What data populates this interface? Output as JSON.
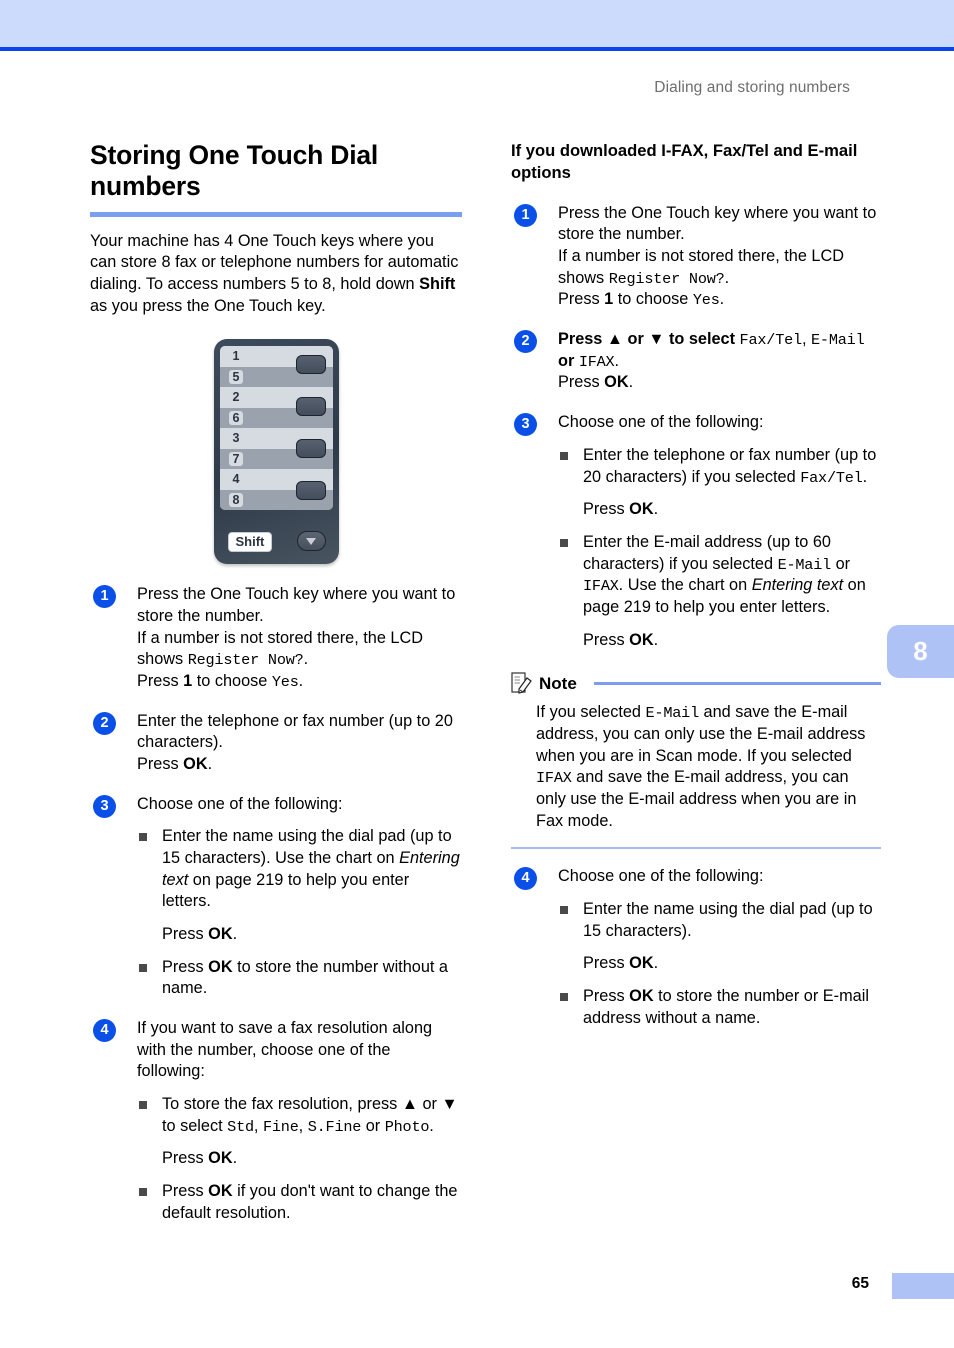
{
  "header": {
    "running_head": "Dialing and storing numbers",
    "band_color": "#ccdafb",
    "rule_color": "#0a44ee"
  },
  "left_column": {
    "title": "Storing One Touch Dial numbers",
    "intro_parts": {
      "a": "Your machine has 4 One Touch keys where you can store 8 fax or telephone numbers for automatic dialing. To access numbers 5 to 8, hold down ",
      "b": "Shift",
      "c": " as you press the One Touch key."
    },
    "figure": {
      "name": "one-touch-keypad",
      "rows": [
        {
          "top": "1",
          "bottom": "5"
        },
        {
          "top": "2",
          "bottom": "6"
        },
        {
          "top": "3",
          "bottom": "7"
        },
        {
          "top": "4",
          "bottom": "8"
        }
      ],
      "shift_label": "Shift",
      "down_icon": "chevron-down-icon"
    },
    "steps": [
      {
        "num": "1",
        "lines": [
          {
            "a": "Press the One Touch key where you want to store the number."
          },
          {
            "a": "If a number is not stored there, the LCD shows ",
            "mono": "Register Now?",
            "c": "."
          },
          {
            "a": "Press ",
            "b": "1",
            "c": " to choose ",
            "mono2": "Yes",
            "d": "."
          }
        ]
      },
      {
        "num": "2",
        "lines": [
          {
            "a": "Enter the telephone or fax number (up to 20 characters)."
          },
          {
            "a": "Press ",
            "b": "OK",
            "c": "."
          }
        ]
      },
      {
        "num": "3",
        "lines": [
          {
            "a": "Choose one of the following:"
          }
        ],
        "bullets": [
          {
            "a": "Enter the name using the dial pad (up to 15 characters). Use the chart on ",
            "italic": "Entering text",
            "c": " on page 219 to help you enter letters.",
            "press": {
              "a": "Press ",
              "b": "OK",
              "c": "."
            }
          },
          {
            "a": "Press ",
            "bold_inline": "OK",
            "c": " to store the number without a name."
          }
        ]
      },
      {
        "num": "4",
        "lines": [
          {
            "a": "If you want to save a fax resolution along with the number, choose one of the following:"
          }
        ],
        "bullets": [
          {
            "a": "To store the fax resolution, press ▲ or ▼ to select ",
            "mono": "Std",
            "sep1": ", ",
            "mono2": "Fine",
            "sep2": ", ",
            "mono3": "S.Fine",
            "sep3": " or ",
            "mono4": "Photo",
            "end": ".",
            "press": {
              "a": "Press ",
              "b": "OK",
              "c": "."
            }
          },
          {
            "a": "Press ",
            "bold_inline": "OK",
            "c": " if you don't want to change the default resolution."
          }
        ]
      }
    ]
  },
  "right_column": {
    "subhead": "If you downloaded I-FAX, Fax/Tel and E-mail options",
    "steps": [
      {
        "num": "1",
        "lines": [
          {
            "a": "Press the One Touch key where you want to store the number."
          },
          {
            "a": "If a number is not stored there, the LCD shows ",
            "mono": "Register Now?",
            "c": "."
          },
          {
            "a": "Press ",
            "b": "1",
            "c": " to choose ",
            "mono2": "Yes",
            "d": "."
          }
        ]
      },
      {
        "num": "2",
        "lines": [
          {
            "a": "Press ▲ or ▼ to select ",
            "mono": "Fax/Tel",
            "sep": ", ",
            "mono2": "E-Mail",
            "sep2": " or ",
            "mono3": "IFAX",
            "end": "."
          },
          {
            "a": "Press ",
            "b": "OK",
            "c": "."
          }
        ]
      },
      {
        "num": "3",
        "lines": [
          {
            "a": "Choose one of the following:"
          }
        ],
        "bullets": [
          {
            "a": "Enter the telephone or fax number (up to 20 characters) if you selected ",
            "mono": "Fax/Tel",
            "end": ".",
            "press": {
              "a": "Press ",
              "b": "OK",
              "c": "."
            }
          },
          {
            "a": "Enter the E-mail address (up to 60 characters) if you selected ",
            "mono": "E-Mail",
            "sep": " or ",
            "mono2": "IFAX",
            "mid": ". Use the chart on ",
            "italic": "Entering text",
            "end": " on page 219 to help you enter letters.",
            "press": {
              "a": "Press ",
              "b": "OK",
              "c": "."
            }
          }
        ]
      }
    ],
    "note": {
      "icon": "note-pencil-icon",
      "title": "Note",
      "body": {
        "a": "If you selected ",
        "mono": "E-Mail",
        "b": " and save the E-mail address, you can only use the E-mail address when you are in Scan mode. If you selected ",
        "mono2": "IFAX",
        "c": " and save the E-mail address, you can only use the E-mail address when you are in Fax mode."
      }
    },
    "step4": {
      "num": "4",
      "lines": [
        {
          "a": "Choose one of the following:"
        }
      ],
      "bullets": [
        {
          "a": "Enter the name using the dial pad (up to 15 characters).",
          "press": {
            "a": "Press ",
            "b": "OK",
            "c": "."
          }
        },
        {
          "a": "Press ",
          "bold_inline": "OK",
          "c": " to store the number or E-mail address without a name."
        }
      ]
    }
  },
  "chapter_tab": {
    "number": "8",
    "color": "#aec2f5"
  },
  "footer": {
    "page_number": "65",
    "block_color": "#aec2f5"
  }
}
